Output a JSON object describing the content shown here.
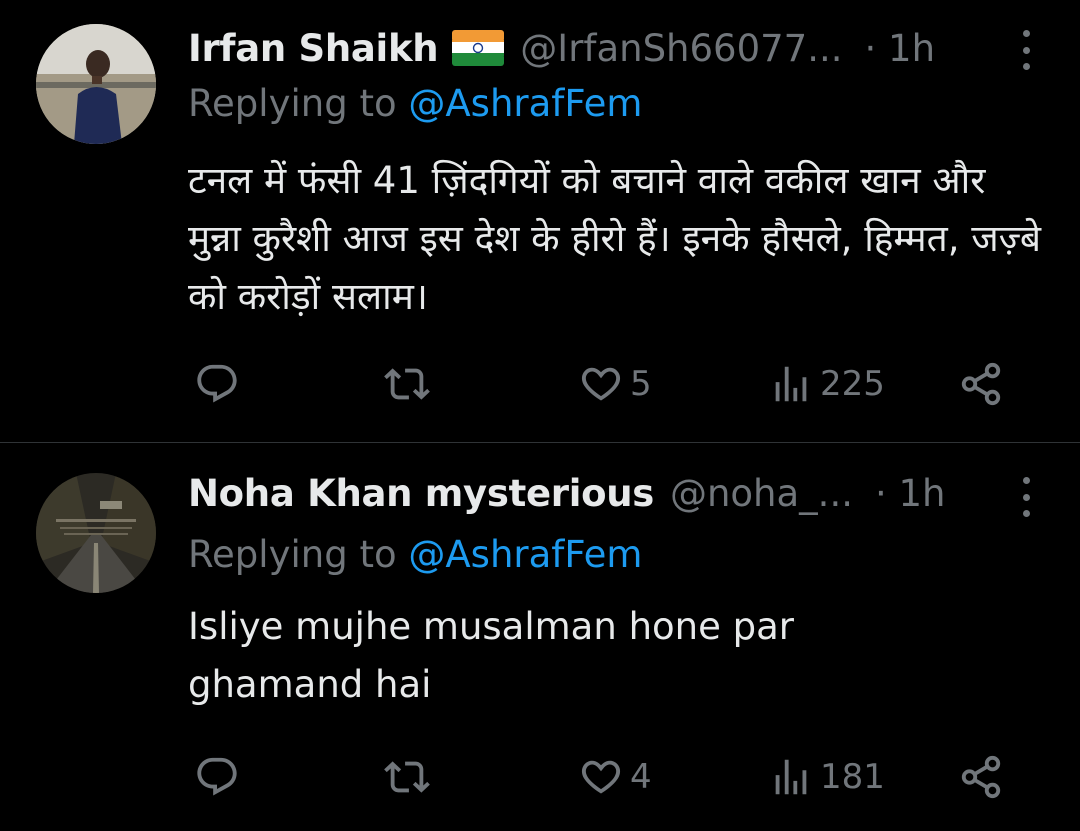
{
  "replies": [
    {
      "display_name": "Irfan Shaikh",
      "flag": "india-flag",
      "handle": "@IrfanSh66077...",
      "time": "· 1h",
      "replying_prefix": "Replying to",
      "replying_mention": "@AshrafFem",
      "text": "टनल में फंसी 41 ज़िंदगियों को बचाने वाले वकील खान और मुन्ना कुरैशी आज इस देश के हीरो हैं। इनके हौसले, हिम्मत, जज़्बे को करोड़ों सलाम।",
      "like_count": "5",
      "view_count": "225"
    },
    {
      "display_name": "Noha Khan mysterious",
      "handle": "@noha_...",
      "time": "· 1h",
      "replying_prefix": "Replying to",
      "replying_mention": "@AshrafFem",
      "text": "Isliye mujhe musalman hone par ghamand hai",
      "like_count": "4",
      "view_count": "181"
    }
  ],
  "icons": {
    "reply": "reply-icon",
    "retweet": "retweet-icon",
    "like": "heart-icon",
    "views": "views-icon",
    "share": "share-icon",
    "more": "more-vertical-icon"
  },
  "colors": {
    "background": "#000000",
    "text": "#e7e9ea",
    "muted": "#71767b",
    "link": "#1d9bf0",
    "divider": "#2f3336"
  }
}
